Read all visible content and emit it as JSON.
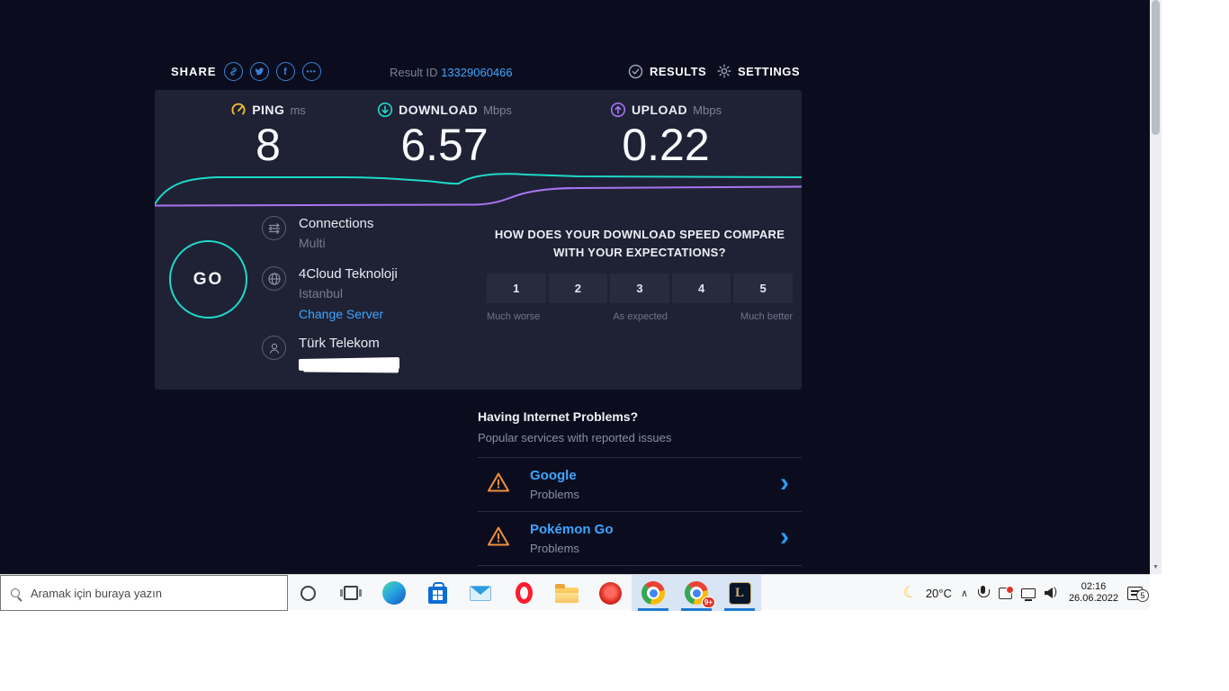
{
  "theme": {
    "page_bg": "#0b0d1f",
    "panel_bg": "#1f2235",
    "link_blue": "#3ea6ff",
    "teal": "#1fd9c8",
    "purple": "#a873f2",
    "yellow": "#f5c132",
    "warning_orange": "#ef8e3c"
  },
  "header": {
    "share_label": "SHARE",
    "result_id_label": "Result ID",
    "result_id": "13329060466",
    "results_label": "RESULTS",
    "settings_label": "SETTINGS"
  },
  "stats": [
    {
      "name": "PING",
      "unit": "ms",
      "value": "8"
    },
    {
      "name": "DOWNLOAD",
      "unit": "Mbps",
      "value": "6.57"
    },
    {
      "name": "UPLOAD",
      "unit": "Mbps",
      "value": "0.22"
    }
  ],
  "go_label": "GO",
  "connection": {
    "connections_label": "Connections",
    "connections_value": "Multi",
    "server_name": "4Cloud Teknoloji",
    "server_city": "Istanbul",
    "change_server_label": "Change Server",
    "isp_name": "Türk Telekom"
  },
  "rating": {
    "question_line1": "HOW DOES YOUR DOWNLOAD SPEED COMPARE",
    "question_line2": "WITH YOUR EXPECTATIONS?",
    "options": [
      "1",
      "2",
      "3",
      "4",
      "5"
    ],
    "label_worse": "Much worse",
    "label_expected": "As expected",
    "label_better": "Much better"
  },
  "problems": {
    "title": "Having Internet Problems?",
    "subtitle": "Popular services with reported issues",
    "items": [
      {
        "name": "Google",
        "status": "Problems"
      },
      {
        "name": "Pokémon Go",
        "status": "Problems"
      }
    ]
  },
  "icons": {
    "facebook_glyph": "f",
    "more_glyph": "•••",
    "chevron_glyph": "›",
    "scroll_down_glyph": "▼",
    "moon_glyph": "☾",
    "caret_glyph": "∧",
    "speaker_wave_glyph": ")",
    "league_glyph": "L"
  },
  "taskbar": {
    "search_placeholder": "Aramak için buraya yazın",
    "chrome_badge": "9+",
    "tray": {
      "temperature": "20°C",
      "time": "02:16",
      "date": "26.06.2022",
      "notification_count": "5"
    }
  }
}
